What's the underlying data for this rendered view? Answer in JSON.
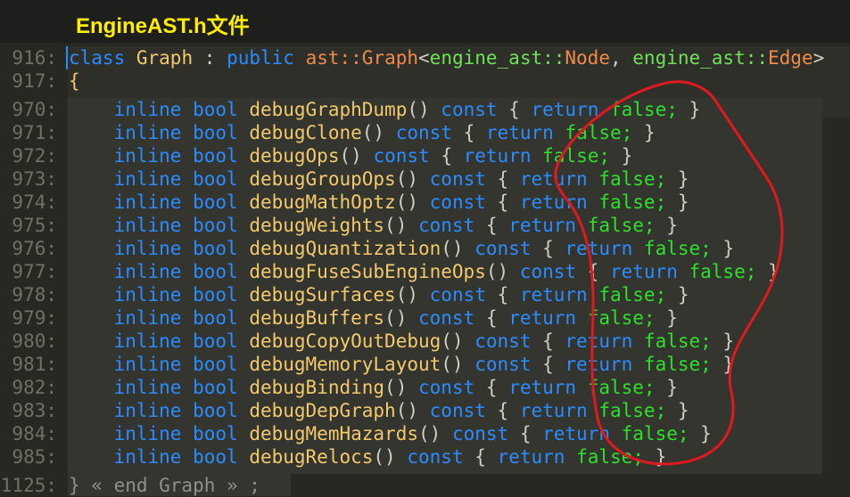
{
  "title": "EngineAST.h文件",
  "header_line": {
    "num": "916:",
    "kw1": "class",
    "name": "Graph",
    "colon": ":",
    "kw2": "public",
    "ns1": "ast::",
    "ty1": "Graph",
    "lt": "<",
    "ns2": "engine_ast::",
    "ty2": "Node",
    "comma": ",",
    "ns3": "engine_ast::",
    "ty3": "Edge",
    "gt": ">"
  },
  "brace_line": {
    "num": "917:",
    "text": "{"
  },
  "methods": [
    {
      "num": "970:",
      "name": "debugGraphDump"
    },
    {
      "num": "971:",
      "name": "debugClone"
    },
    {
      "num": "972:",
      "name": "debugOps"
    },
    {
      "num": "973:",
      "name": "debugGroupOps"
    },
    {
      "num": "974:",
      "name": "debugMathOptz"
    },
    {
      "num": "975:",
      "name": "debugWeights"
    },
    {
      "num": "976:",
      "name": "debugQuantization"
    },
    {
      "num": "977:",
      "name": "debugFuseSubEngineOps"
    },
    {
      "num": "978:",
      "name": "debugSurfaces"
    },
    {
      "num": "979:",
      "name": "debugBuffers"
    },
    {
      "num": "980:",
      "name": "debugCopyOutDebug"
    },
    {
      "num": "981:",
      "name": "debugMemoryLayout"
    },
    {
      "num": "982:",
      "name": "debugBinding"
    },
    {
      "num": "983:",
      "name": "debugDepGraph"
    },
    {
      "num": "984:",
      "name": "debugMemHazards"
    },
    {
      "num": "985:",
      "name": "debugRelocs"
    }
  ],
  "tokens": {
    "inline": "inline",
    "bool": "bool",
    "parens": "()",
    "const": "const",
    "open": "{",
    "ret": "return",
    "false": "false;",
    "close": "}"
  },
  "end_line": {
    "num": "1125:",
    "text": "} « end Graph » ;"
  }
}
